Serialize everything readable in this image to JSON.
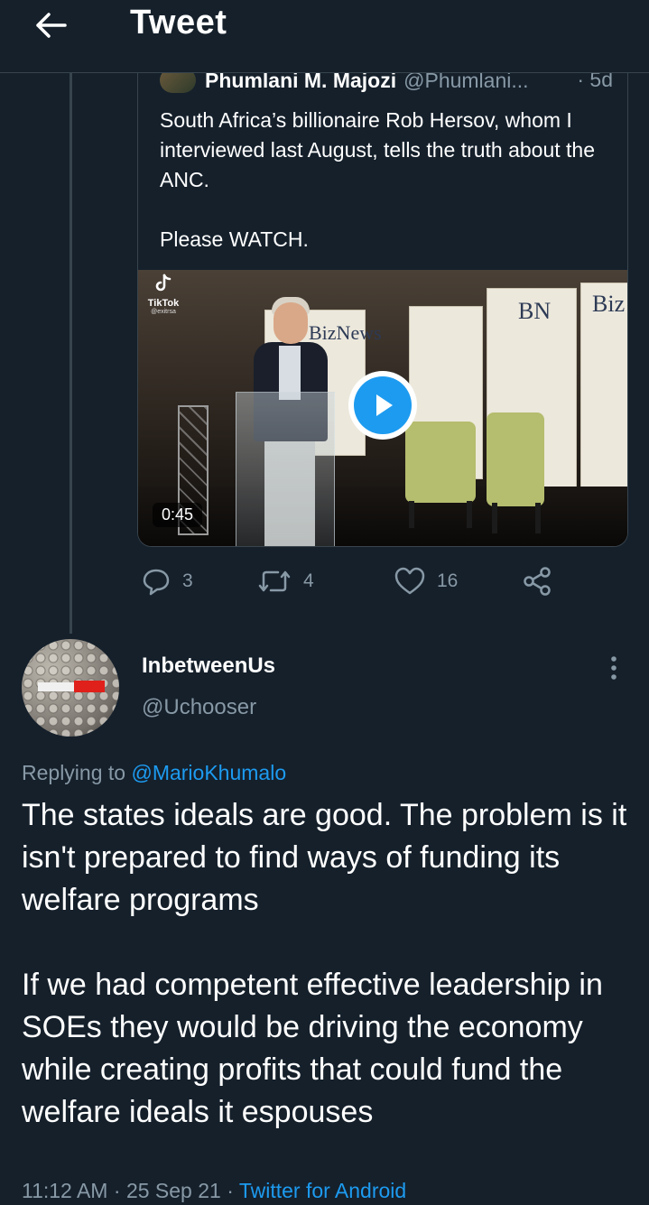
{
  "header": {
    "title": "Tweet",
    "back_icon": "arrow-left-icon"
  },
  "quoted_tweet": {
    "author_name": "Phumlani M. Majozi",
    "author_handle": "@Phumlani...",
    "time": "· 5d",
    "text_paragraphs": [
      "South Africa’s billionaire Rob Hersov, whom I interviewed last August, tells the truth about the ANC.",
      "Please WATCH."
    ],
    "video": {
      "duration": "0:45",
      "watermark_name": "TikTok",
      "watermark_handle": "@exitrsa",
      "banner_text_left": "BizNews",
      "banner_text_right": "BN",
      "banner_text_biz": "Biz",
      "play_icon": "play-icon"
    }
  },
  "actions": {
    "reply_count": "3",
    "retweet_count": "4",
    "like_count": "16",
    "icons": [
      "reply-icon",
      "retweet-icon",
      "heart-icon",
      "share-icon"
    ]
  },
  "reply": {
    "name": "InbetweenUs",
    "handle": "@Uchooser",
    "more_icon": "more-vertical-icon",
    "replying_prefix": "Replying to",
    "replying_to": "@MarioKhumalo",
    "text_paragraphs": [
      "The states ideals are good. The problem is it isn't prepared to find ways of funding its welfare programs",
      "If we had competent effective leadership in SOEs they would be driving the economy while creating profits that could fund the welfare ideals it espouses"
    ],
    "time": "11:12 AM",
    "date": "25 Sep 21",
    "separator": " · ",
    "app": "Twitter for Android"
  },
  "colors": {
    "background": "#15202b",
    "border": "#38444d",
    "secondary_text": "#8899a6",
    "accent": "#1d9bf0"
  }
}
